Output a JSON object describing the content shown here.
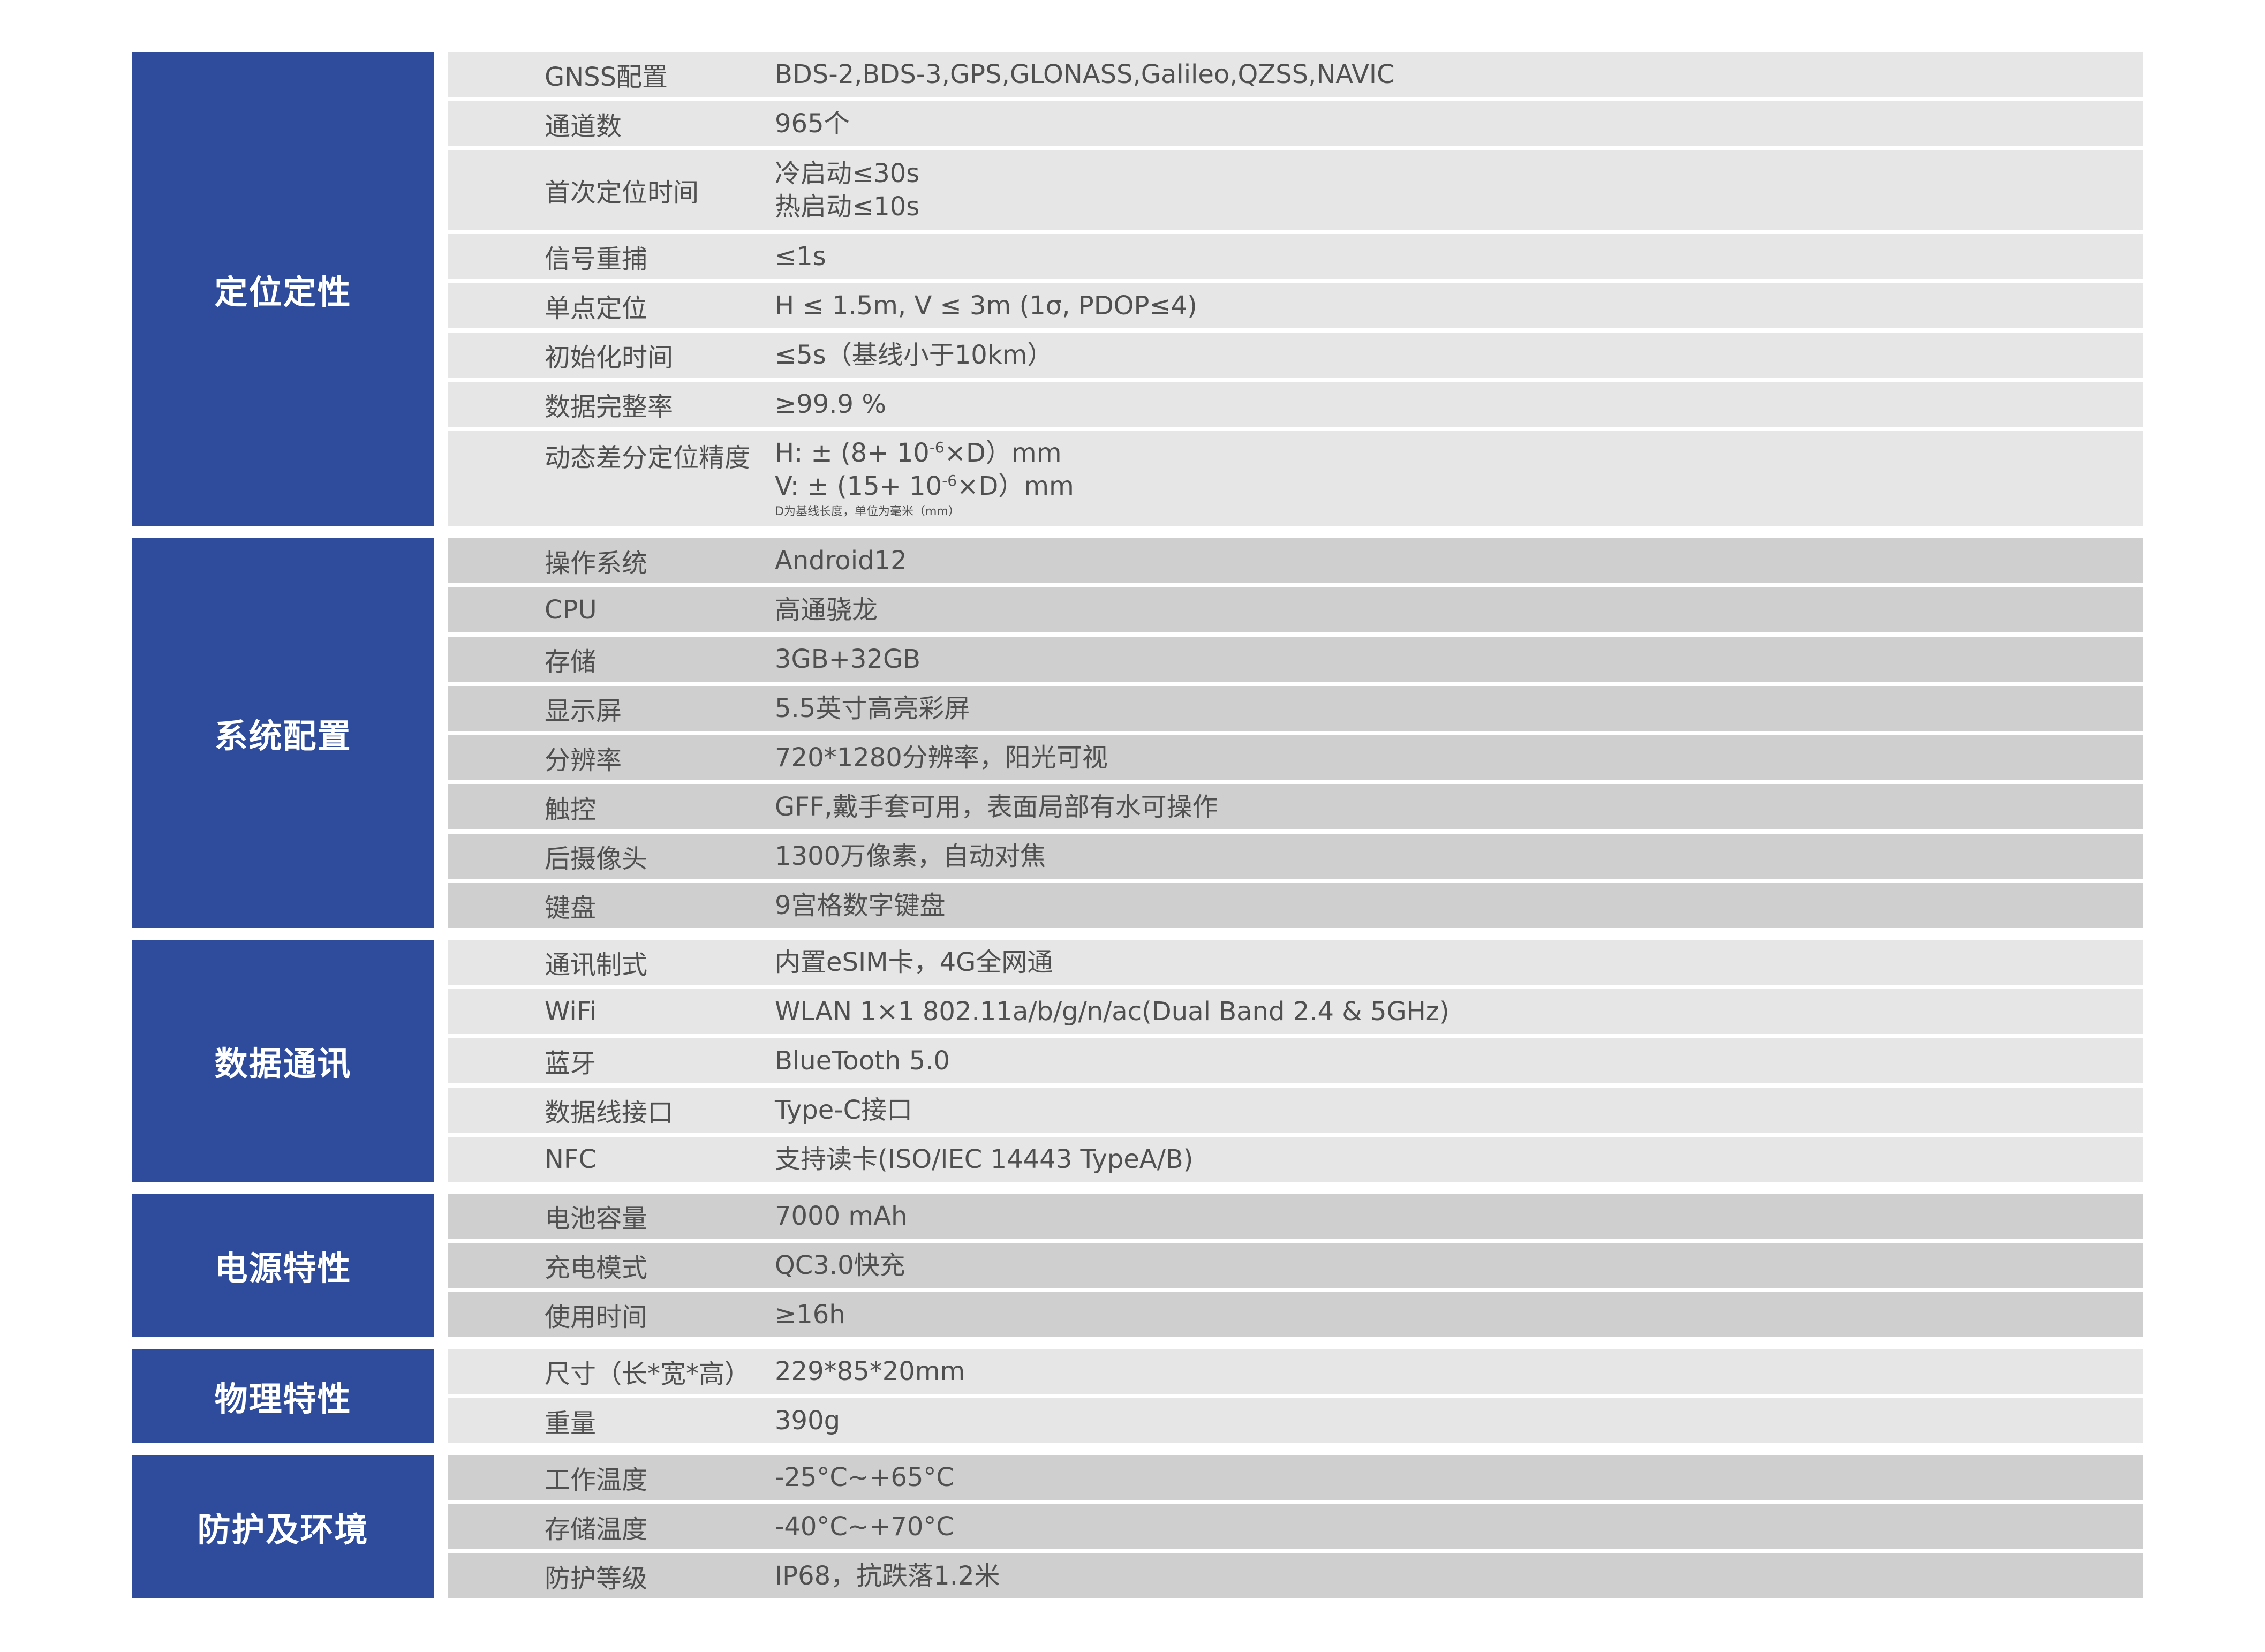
{
  "sections": [
    {
      "title": "定位定性",
      "rows": [
        {
          "label": "GNSS配置",
          "value": "BDS-2,BDS-3,GPS,GLONASS,Galileo,QZSS,NAVIC"
        },
        {
          "label": "通道数",
          "value": "965个"
        },
        {
          "label": "首次定位时间",
          "value1": "冷启动≤30s",
          "value2": "热启动≤10s"
        },
        {
          "label": "信号重捕",
          "value": "≤1s"
        },
        {
          "label": "单点定位",
          "value": "H ≤ 1.5m, V ≤ 3m (1σ, PDOP≤4)"
        },
        {
          "label": "初始化时间",
          "value": "≤5s（基线小于10km）"
        },
        {
          "label": "数据完整率",
          "value": "≥99.9 %"
        },
        {
          "label": "动态差分定位精度",
          "h_prefix": "H: ± (8+ 10",
          "v_prefix": "V: ± (15+ 10",
          "exp": "-6",
          "suffix": "×D）mm",
          "note": "D为基线长度，单位为毫米（mm）"
        }
      ]
    },
    {
      "title": "系统配置",
      "rows": [
        {
          "label": "操作系统",
          "value": "Android12"
        },
        {
          "label": "CPU",
          "value": "高通骁龙"
        },
        {
          "label": "存储",
          "value": "3GB+32GB"
        },
        {
          "label": "显示屏",
          "value": "5.5英寸高亮彩屏"
        },
        {
          "label": "分辨率",
          "value": "720*1280分辨率，阳光可视"
        },
        {
          "label": "触控",
          "value": "GFF,戴手套可用，表面局部有水可操作"
        },
        {
          "label": "后摄像头",
          "value": "1300万像素，自动对焦"
        },
        {
          "label": "键盘",
          "value": "9宫格数字键盘"
        }
      ]
    },
    {
      "title": "数据通讯",
      "rows": [
        {
          "label": "通讯制式",
          "value": "内置eSIM卡，4G全网通"
        },
        {
          "label": "WiFi",
          "value": "WLAN 1×1 802.11a/b/g/n/ac(Dual Band 2.4 & 5GHz)"
        },
        {
          "label": "蓝牙",
          "value": "BlueTooth 5.0"
        },
        {
          "label": "数据线接口",
          "value": "Type-C接口"
        },
        {
          "label": "NFC",
          "value": "支持读卡(ISO/IEC 14443 TypeA/B)"
        }
      ]
    },
    {
      "title": "电源特性",
      "rows": [
        {
          "label": "电池容量",
          "value": "7000 mAh"
        },
        {
          "label": "充电模式",
          "value": "QC3.0快充"
        },
        {
          "label": "使用时间",
          "value": "≥16h"
        }
      ]
    },
    {
      "title": "物理特性",
      "rows": [
        {
          "label": "尺寸（长*宽*高）",
          "value": "229*85*20mm"
        },
        {
          "label": "重量",
          "value": "390g"
        }
      ]
    },
    {
      "title": "防护及环境",
      "rows": [
        {
          "label": "工作温度",
          "value": "-25°C~+65°C"
        },
        {
          "label": "存储温度",
          "value": "-40°C~+70°C"
        },
        {
          "label": "防护等级",
          "value": "IP68，抗跌落1.2米"
        }
      ]
    }
  ],
  "colors": {
    "category_bg": "#2e4c9b",
    "row_light": "#e6e6e6",
    "row_dark": "#cfcfcf",
    "text": "#505050"
  }
}
